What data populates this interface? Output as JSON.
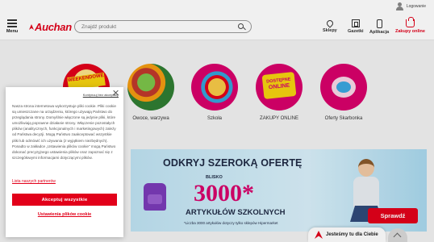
{
  "top": {
    "login_label": "Logowanie"
  },
  "header": {
    "menu_label": "Menu",
    "logo_text": "Auchan",
    "search_placeholder": "Znajdź produkt",
    "nav": [
      {
        "label": "Sklepy",
        "icon": "location-pin-icon"
      },
      {
        "label": "Gazetki",
        "icon": "newspaper-icon"
      },
      {
        "label": "Aplikacja",
        "icon": "phone-icon"
      },
      {
        "label": "Zakupy online",
        "icon": "shopping-bag-icon"
      }
    ]
  },
  "categories": [
    {
      "label": "",
      "badge": "WEEKENDOWE"
    },
    {
      "label": "Owoce, warzywa"
    },
    {
      "label": "Szkoła"
    },
    {
      "label": "ZAKUPY ONLINE",
      "tag_top": "DOSTĘPNE",
      "tag_main": "ONLINE"
    },
    {
      "label": "Oferty Skarbonka"
    }
  ],
  "promo": {
    "headline": "ODKRYJ SZEROKĄ OFERTĘ",
    "prefix": "BLISKO",
    "number": "3000*",
    "subline": "ARTYKUŁÓW SZKOLNYCH",
    "note": "*Liczba 3000 artykułów dotyczy tylko sklepów Hipermarket",
    "cta": "Sprawdź"
  },
  "help": {
    "label": "Jesteśmy tu dla Ciebie"
  },
  "cookie": {
    "reject_label": "Kontynuuj bez akceptacji",
    "body": "Nasza strona internetowa wykorzystuje pliki cookie. Pliki cookie są umieszczane na urządzeniu, którego używają Państwo do przeglądania strony. Domyślnie włączone są jedynie pliki, które umożliwiają poprawne działanie strony. Włączenie pozostałych plików (analitycznych, funkcjonalnych i marketingowych) zależy od Państwa decyzji. Mogą Państwo zaakceptować wszystkie pliki lub odmówić ich używania (z wyjątkiem niezbędnych). Ponadto w zakładce „Ustawienia plików cookie\" mogą Państwo dokonać precyzyjnego ustawienia plików oraz zapoznać się z szczegółowymi informacjami dotyczącymi plików.",
    "partners_link": "Lista naszych partnerów",
    "accept_label": "Akceptuj wszystkie",
    "settings_label": "Ustawienia plików cookie"
  },
  "colors": {
    "brand_red": "#e2001a",
    "magenta": "#d8006b",
    "navy": "#1f2a44"
  }
}
